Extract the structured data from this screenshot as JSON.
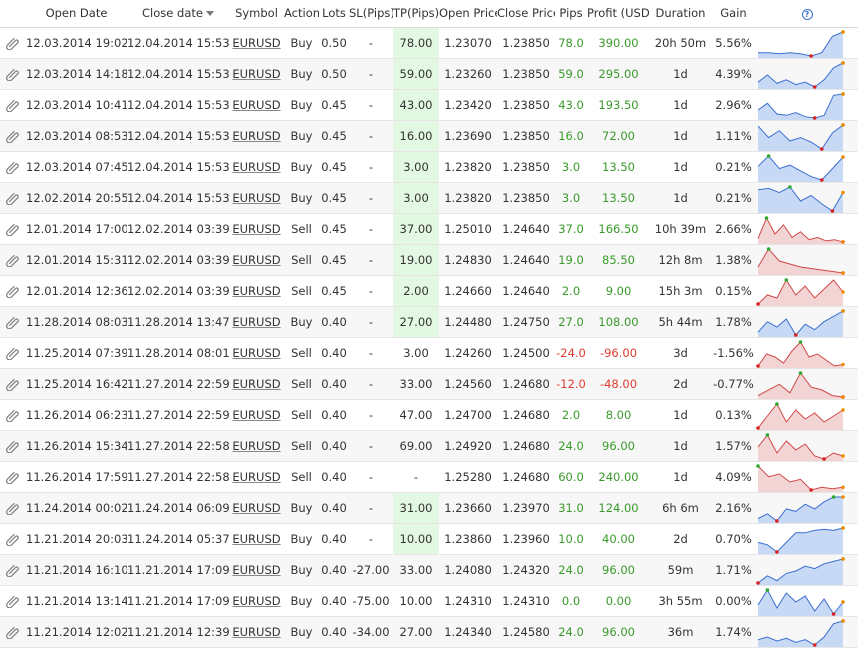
{
  "headers": {
    "open_date": "Open Date",
    "close_date": "Close date",
    "symbol": "Symbol",
    "action": "Action",
    "lots": "Lots",
    "sl": "SL(Pips)",
    "tp": "TP(Pips)",
    "open_price": "Open Price",
    "close_price": "Close Price",
    "pips": "Pips",
    "profit": "Profit (USD)",
    "duration": "Duration",
    "gain": "Gain",
    "help": "?"
  },
  "colors": {
    "positive": "#3a9a2b",
    "negative": "#e03c31",
    "tp_highlight": "#e2f8e2",
    "buy_fill": "#c8d9f5",
    "buy_line": "#3a6fd0",
    "sell_fill": "#f3d4d4",
    "sell_line": "#d04848"
  },
  "icons": {
    "row_icon": "paperclip-icon",
    "sort_icon": "sort-desc-icon",
    "help_icon": "help-icon"
  },
  "trades": [
    {
      "open_date": "12.03.2014 19:02",
      "close_date": "12.04.2014 15:53",
      "symbol": "EURUSD",
      "action": "Buy",
      "lots": "0.50",
      "sl": "-",
      "tp": "78.00",
      "tp_hit": true,
      "open_price": "1.23070",
      "close_price": "1.23850",
      "pips": "78.0",
      "profit": "390.00",
      "duration": "20h 50m",
      "gain": "5.56%",
      "spark": [
        5,
        5,
        4,
        5,
        4,
        2,
        5,
        20,
        24
      ]
    },
    {
      "open_date": "12.03.2014 14:18",
      "close_date": "12.04.2014 15:53",
      "symbol": "EURUSD",
      "action": "Buy",
      "lots": "0.50",
      "sl": "-",
      "tp": "59.00",
      "tp_hit": true,
      "open_price": "1.23260",
      "close_price": "1.23850",
      "pips": "59.0",
      "profit": "295.00",
      "duration": "1d",
      "gain": "4.39%",
      "spark": [
        6,
        12,
        5,
        8,
        4,
        6,
        2,
        8,
        18,
        22
      ]
    },
    {
      "open_date": "12.03.2014 10:41",
      "close_date": "12.04.2014 15:53",
      "symbol": "EURUSD",
      "action": "Buy",
      "lots": "0.45",
      "sl": "-",
      "tp": "43.00",
      "tp_hit": true,
      "open_price": "1.23420",
      "close_price": "1.23850",
      "pips": "43.0",
      "profit": "193.50",
      "duration": "1d",
      "gain": "2.96%",
      "spark": [
        9,
        14,
        6,
        5,
        7,
        4,
        3,
        5,
        20,
        21
      ]
    },
    {
      "open_date": "12.03.2014 08:53",
      "close_date": "12.04.2014 15:53",
      "symbol": "EURUSD",
      "action": "Buy",
      "lots": "0.45",
      "sl": "-",
      "tp": "16.00",
      "tp_hit": true,
      "open_price": "1.23690",
      "close_price": "1.23850",
      "pips": "16.0",
      "profit": "72.00",
      "duration": "1d",
      "gain": "1.11%",
      "spark": [
        22,
        12,
        18,
        9,
        12,
        8,
        2,
        16,
        23
      ]
    },
    {
      "open_date": "12.03.2014 07:45",
      "close_date": "12.04.2014 15:53",
      "symbol": "EURUSD",
      "action": "Buy",
      "lots": "0.45",
      "sl": "-",
      "tp": "3.00",
      "tp_hit": true,
      "open_price": "1.23820",
      "close_price": "1.23850",
      "pips": "3.0",
      "profit": "13.50",
      "duration": "1d",
      "gain": "0.21%",
      "spark": [
        14,
        23,
        12,
        15,
        10,
        5,
        2,
        12,
        22
      ]
    },
    {
      "open_date": "12.02.2014 20:55",
      "close_date": "12.04.2014 15:53",
      "symbol": "EURUSD",
      "action": "Buy",
      "lots": "0.45",
      "sl": "-",
      "tp": "3.00",
      "tp_hit": true,
      "open_price": "1.23820",
      "close_price": "1.23850",
      "pips": "3.0",
      "profit": "13.50",
      "duration": "1d",
      "gain": "0.21%",
      "spark": [
        18,
        19,
        16,
        20,
        10,
        14,
        8,
        3,
        16
      ]
    },
    {
      "open_date": "12.01.2014 17:00",
      "close_date": "12.02.2014 03:39",
      "symbol": "EURUSD",
      "action": "Sell",
      "lots": "0.45",
      "sl": "-",
      "tp": "37.00",
      "tp_hit": true,
      "open_price": "1.25010",
      "close_price": "1.24640",
      "pips": "37.0",
      "profit": "166.50",
      "duration": "10h 39m",
      "gain": "2.66%",
      "spark": [
        4,
        22,
        8,
        16,
        5,
        10,
        3,
        5,
        2,
        3,
        1
      ]
    },
    {
      "open_date": "12.01.2014 15:31",
      "close_date": "12.02.2014 03:39",
      "symbol": "EURUSD",
      "action": "Sell",
      "lots": "0.45",
      "sl": "-",
      "tp": "19.00",
      "tp_hit": true,
      "open_price": "1.24830",
      "close_price": "1.24640",
      "pips": "19.0",
      "profit": "85.50",
      "duration": "12h 8m",
      "gain": "1.38%",
      "spark": [
        6,
        18,
        10,
        8,
        6,
        5,
        4,
        3,
        2
      ]
    },
    {
      "open_date": "12.01.2014 12:36",
      "close_date": "12.02.2014 03:39",
      "symbol": "EURUSD",
      "action": "Sell",
      "lots": "0.45",
      "sl": "-",
      "tp": "2.00",
      "tp_hit": true,
      "open_price": "1.24660",
      "close_price": "1.24640",
      "pips": "2.0",
      "profit": "9.00",
      "duration": "15h 3m",
      "gain": "0.15%",
      "spark": [
        2,
        8,
        6,
        18,
        8,
        14,
        6,
        12,
        18,
        10
      ]
    },
    {
      "open_date": "11.28.2014 08:03",
      "close_date": "11.28.2014 13:47",
      "symbol": "EURUSD",
      "action": "Buy",
      "lots": "0.40",
      "sl": "-",
      "tp": "27.00",
      "tp_hit": true,
      "open_price": "1.24480",
      "close_price": "1.24750",
      "pips": "27.0",
      "profit": "108.00",
      "duration": "5h 44m",
      "gain": "1.78%",
      "spark": [
        6,
        14,
        10,
        16,
        4,
        12,
        8,
        14,
        18,
        22
      ]
    },
    {
      "open_date": "11.25.2014 07:39",
      "close_date": "11.28.2014 08:01",
      "symbol": "EURUSD",
      "action": "Sell",
      "lots": "0.40",
      "sl": "-",
      "tp": "3.00",
      "tp_hit": false,
      "open_price": "1.24260",
      "close_price": "1.24500",
      "pips": "-24.0",
      "profit": "-96.00",
      "duration": "3d",
      "gain": "-1.56%",
      "spark": [
        4,
        12,
        10,
        6,
        14,
        20,
        10,
        12,
        8,
        4,
        5
      ]
    },
    {
      "open_date": "11.25.2014 16:42",
      "close_date": "11.27.2014 22:59",
      "symbol": "EURUSD",
      "action": "Sell",
      "lots": "0.40",
      "sl": "-",
      "tp": "33.00",
      "tp_hit": false,
      "open_price": "1.24560",
      "close_price": "1.24680",
      "pips": "-12.0",
      "profit": "-48.00",
      "duration": "2d",
      "gain": "-0.77%",
      "spark": [
        4,
        8,
        12,
        6,
        20,
        10,
        8,
        4,
        3
      ]
    },
    {
      "open_date": "11.26.2014 06:23",
      "close_date": "11.27.2014 22:59",
      "symbol": "EURUSD",
      "action": "Sell",
      "lots": "0.40",
      "sl": "-",
      "tp": "47.00",
      "tp_hit": false,
      "open_price": "1.24700",
      "close_price": "1.24680",
      "pips": "2.0",
      "profit": "8.00",
      "duration": "1d",
      "gain": "0.13%",
      "spark": [
        2,
        10,
        18,
        6,
        14,
        8,
        12,
        6,
        10,
        14
      ]
    },
    {
      "open_date": "11.26.2014 15:34",
      "close_date": "11.27.2014 22:58",
      "symbol": "EURUSD",
      "action": "Sell",
      "lots": "0.40",
      "sl": "-",
      "tp": "69.00",
      "tp_hit": false,
      "open_price": "1.24920",
      "close_price": "1.24680",
      "pips": "24.0",
      "profit": "96.00",
      "duration": "1d",
      "gain": "1.57%",
      "spark": [
        12,
        20,
        8,
        16,
        10,
        14,
        6,
        4,
        8,
        6
      ]
    },
    {
      "open_date": "11.26.2014 17:59",
      "close_date": "11.27.2014 22:58",
      "symbol": "EURUSD",
      "action": "Sell",
      "lots": "0.40",
      "sl": "-",
      "tp": "-",
      "tp_hit": false,
      "open_price": "1.25280",
      "close_price": "1.24680",
      "pips": "60.0",
      "profit": "240.00",
      "duration": "1d",
      "gain": "4.09%",
      "spark": [
        20,
        12,
        14,
        8,
        10,
        2,
        4,
        3,
        4
      ]
    },
    {
      "open_date": "11.24.2014 00:02",
      "close_date": "11.24.2014 06:09",
      "symbol": "EURUSD",
      "action": "Buy",
      "lots": "0.40",
      "sl": "-",
      "tp": "31.00",
      "tp_hit": true,
      "open_price": "1.23660",
      "close_price": "1.23970",
      "pips": "31.0",
      "profit": "124.00",
      "duration": "6h 6m",
      "gain": "2.16%",
      "spark": [
        4,
        8,
        2,
        12,
        10,
        16,
        12,
        18,
        22,
        22
      ]
    },
    {
      "open_date": "11.21.2014 20:03",
      "close_date": "11.24.2014 05:37",
      "symbol": "EURUSD",
      "action": "Buy",
      "lots": "0.40",
      "sl": "-",
      "tp": "10.00",
      "tp_hit": true,
      "open_price": "1.23860",
      "close_price": "1.23960",
      "pips": "10.0",
      "profit": "40.00",
      "duration": "2d",
      "gain": "0.70%",
      "spark": [
        10,
        8,
        2,
        10,
        18,
        18,
        20,
        21,
        20,
        22
      ]
    },
    {
      "open_date": "11.21.2014 16:10",
      "close_date": "11.21.2014 17:09",
      "symbol": "EURUSD",
      "action": "Buy",
      "lots": "0.40",
      "sl": "-27.00",
      "tp": "33.00",
      "tp_hit": false,
      "open_price": "1.24080",
      "close_price": "1.24320",
      "pips": "24.0",
      "profit": "96.00",
      "duration": "59m",
      "gain": "1.71%",
      "spark": [
        2,
        8,
        4,
        10,
        12,
        16,
        14,
        18,
        20,
        22
      ]
    },
    {
      "open_date": "11.21.2014 13:14",
      "close_date": "11.21.2014 17:09",
      "symbol": "EURUSD",
      "action": "Buy",
      "lots": "0.40",
      "sl": "-75.00",
      "tp": "10.00",
      "tp_hit": false,
      "open_price": "1.24310",
      "close_price": "1.24310",
      "pips": "0.0",
      "profit": "0.00",
      "duration": "3h 55m",
      "gain": "0.00%",
      "spark": [
        10,
        20,
        8,
        18,
        12,
        16,
        6,
        14,
        4,
        12
      ]
    },
    {
      "open_date": "11.21.2014 12:02",
      "close_date": "11.21.2014 12:39",
      "symbol": "EURUSD",
      "action": "Buy",
      "lots": "0.40",
      "sl": "-34.00",
      "tp": "27.00",
      "tp_hit": false,
      "open_price": "1.24340",
      "close_price": "1.24580",
      "pips": "24.0",
      "profit": "96.00",
      "duration": "36m",
      "gain": "1.74%",
      "spark": [
        6,
        8,
        5,
        7,
        4,
        6,
        2,
        8,
        18,
        20
      ]
    }
  ]
}
